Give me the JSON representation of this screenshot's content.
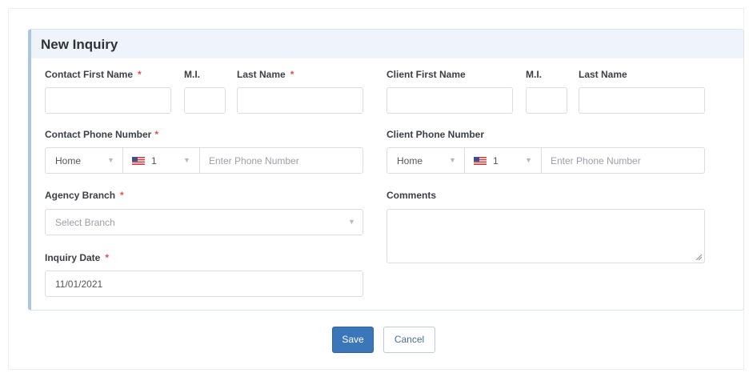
{
  "form": {
    "title": "New Inquiry",
    "required_mark": "*",
    "contact_first_name_label": "Contact First Name",
    "contact_mi_label": "M.I.",
    "contact_last_name_label": "Last Name",
    "client_first_name_label": "Client First Name",
    "client_mi_label": "M.I.",
    "client_last_name_label": "Last Name",
    "contact_phone_label": "Contact Phone Number",
    "client_phone_label": "Client Phone Number",
    "contact_phone_type": "Home",
    "contact_country_code": "1",
    "contact_phone_placeholder": "Enter Phone Number",
    "client_phone_type": "Home",
    "client_country_code": "1",
    "client_phone_placeholder": "Enter Phone Number",
    "agency_branch_label": "Agency Branch",
    "agency_branch_placeholder": "Select Branch",
    "comments_label": "Comments",
    "inquiry_date_label": "Inquiry Date",
    "inquiry_date_value": "11/01/2021",
    "country_flag_icon": "us-flag-icon",
    "dropdown_icon": "chevron-down-icon"
  },
  "actions": {
    "save_label": "Save",
    "cancel_label": "Cancel"
  },
  "colors": {
    "accent": "#3a76b8",
    "required": "#d9534f",
    "panel_header_bg": "#eef4fa",
    "panel_left_border": "#a9c6e4"
  }
}
